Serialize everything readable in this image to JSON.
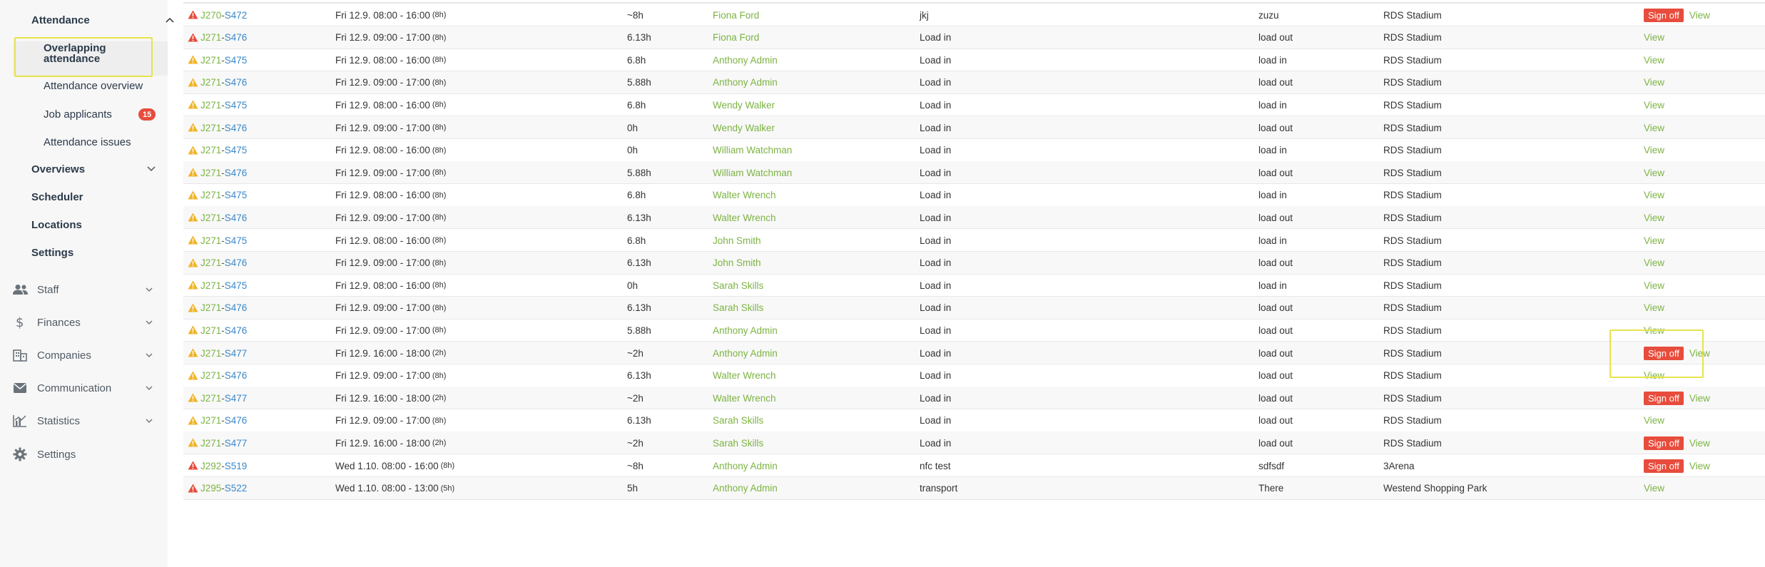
{
  "sidebar": {
    "attendance": "Attendance",
    "sub_items": [
      {
        "label": "Overlapping attendance",
        "key": "overlapping"
      },
      {
        "label": "Attendance overview",
        "key": "overview"
      },
      {
        "label": "Job applicants",
        "key": "applicants",
        "badge": "15"
      },
      {
        "label": "Attendance issues",
        "key": "issues"
      }
    ],
    "sections": [
      "Overviews",
      "Scheduler",
      "Locations",
      "Settings"
    ],
    "groups": [
      {
        "label": "Staff",
        "icon": "people-icon"
      },
      {
        "label": "Finances",
        "icon": "dollar-icon"
      },
      {
        "label": "Companies",
        "icon": "building-icon"
      },
      {
        "label": "Communication",
        "icon": "envelope-icon"
      },
      {
        "label": "Statistics",
        "icon": "chart-icon"
      }
    ],
    "settings": {
      "label": "Settings",
      "icon": "gear-icon"
    }
  },
  "labels": {
    "sign_off": "Sign off",
    "view": "View"
  },
  "colors": {
    "green": "#7cb342",
    "blue": "#3a87c8",
    "red": "#e74c3c",
    "warn_yellow": "#f0b429",
    "highlight": "#e7e34a"
  },
  "rows": [
    {
      "alert": "red",
      "job": "J270",
      "shift": "S472",
      "time": "Fri 12.9. 08:00 - 16:00",
      "hours": "(8h)",
      "duration": "~8h",
      "name": "Fiona Ford",
      "task": "jkj",
      "position": "zuzu",
      "location": "RDS Stadium",
      "sign_off": true
    },
    {
      "alert": "red",
      "job": "J271",
      "shift": "S476",
      "time": "Fri 12.9. 09:00 - 17:00",
      "hours": "(8h)",
      "duration": "6.13h",
      "name": "Fiona Ford",
      "task": "Load in",
      "position": "load out",
      "location": "RDS Stadium",
      "sign_off": false
    },
    {
      "alert": "yellow",
      "job": "J271",
      "shift": "S475",
      "time": "Fri 12.9. 08:00 - 16:00",
      "hours": "(8h)",
      "duration": "6.8h",
      "name": "Anthony Admin",
      "task": "Load in",
      "position": "load in",
      "location": "RDS Stadium",
      "sign_off": false
    },
    {
      "alert": "yellow",
      "job": "J271",
      "shift": "S476",
      "time": "Fri 12.9. 09:00 - 17:00",
      "hours": "(8h)",
      "duration": "5.88h",
      "name": "Anthony Admin",
      "task": "Load in",
      "position": "load out",
      "location": "RDS Stadium",
      "sign_off": false
    },
    {
      "alert": "yellow",
      "job": "J271",
      "shift": "S475",
      "time": "Fri 12.9. 08:00 - 16:00",
      "hours": "(8h)",
      "duration": "6.8h",
      "name": "Wendy Walker",
      "task": "Load in",
      "position": "load in",
      "location": "RDS Stadium",
      "sign_off": false
    },
    {
      "alert": "yellow",
      "job": "J271",
      "shift": "S476",
      "time": "Fri 12.9. 09:00 - 17:00",
      "hours": "(8h)",
      "duration": "0h",
      "name": "Wendy Walker",
      "task": "Load in",
      "position": "load out",
      "location": "RDS Stadium",
      "sign_off": false
    },
    {
      "alert": "yellow",
      "job": "J271",
      "shift": "S475",
      "time": "Fri 12.9. 08:00 - 16:00",
      "hours": "(8h)",
      "duration": "0h",
      "name": "William Watchman",
      "task": "Load in",
      "position": "load in",
      "location": "RDS Stadium",
      "sign_off": false
    },
    {
      "alert": "yellow",
      "job": "J271",
      "shift": "S476",
      "time": "Fri 12.9. 09:00 - 17:00",
      "hours": "(8h)",
      "duration": "5.88h",
      "name": "William Watchman",
      "task": "Load in",
      "position": "load out",
      "location": "RDS Stadium",
      "sign_off": false
    },
    {
      "alert": "yellow",
      "job": "J271",
      "shift": "S475",
      "time": "Fri 12.9. 08:00 - 16:00",
      "hours": "(8h)",
      "duration": "6.8h",
      "name": "Walter Wrench",
      "task": "Load in",
      "position": "load in",
      "location": "RDS Stadium",
      "sign_off": false
    },
    {
      "alert": "yellow",
      "job": "J271",
      "shift": "S476",
      "time": "Fri 12.9. 09:00 - 17:00",
      "hours": "(8h)",
      "duration": "6.13h",
      "name": "Walter Wrench",
      "task": "Load in",
      "position": "load out",
      "location": "RDS Stadium",
      "sign_off": false
    },
    {
      "alert": "yellow",
      "job": "J271",
      "shift": "S475",
      "time": "Fri 12.9. 08:00 - 16:00",
      "hours": "(8h)",
      "duration": "6.8h",
      "name": "John Smith",
      "task": "Load in",
      "position": "load in",
      "location": "RDS Stadium",
      "sign_off": false
    },
    {
      "alert": "yellow",
      "job": "J271",
      "shift": "S476",
      "time": "Fri 12.9. 09:00 - 17:00",
      "hours": "(8h)",
      "duration": "6.13h",
      "name": "John Smith",
      "task": "Load in",
      "position": "load out",
      "location": "RDS Stadium",
      "sign_off": false
    },
    {
      "alert": "yellow",
      "job": "J271",
      "shift": "S475",
      "time": "Fri 12.9. 08:00 - 16:00",
      "hours": "(8h)",
      "duration": "0h",
      "name": "Sarah Skills",
      "task": "Load in",
      "position": "load in",
      "location": "RDS Stadium",
      "sign_off": false
    },
    {
      "alert": "yellow",
      "job": "J271",
      "shift": "S476",
      "time": "Fri 12.9. 09:00 - 17:00",
      "hours": "(8h)",
      "duration": "6.13h",
      "name": "Sarah Skills",
      "task": "Load in",
      "position": "load out",
      "location": "RDS Stadium",
      "sign_off": false
    },
    {
      "alert": "yellow",
      "job": "J271",
      "shift": "S476",
      "time": "Fri 12.9. 09:00 - 17:00",
      "hours": "(8h)",
      "duration": "5.88h",
      "name": "Anthony Admin",
      "task": "Load in",
      "position": "load out",
      "location": "RDS Stadium",
      "sign_off": false
    },
    {
      "alert": "yellow",
      "job": "J271",
      "shift": "S477",
      "time": "Fri 12.9. 16:00 - 18:00",
      "hours": "(2h)",
      "duration": "~2h",
      "name": "Anthony Admin",
      "task": "Load in",
      "position": "load out",
      "location": "RDS Stadium",
      "sign_off": true
    },
    {
      "alert": "yellow",
      "job": "J271",
      "shift": "S476",
      "time": "Fri 12.9. 09:00 - 17:00",
      "hours": "(8h)",
      "duration": "6.13h",
      "name": "Walter Wrench",
      "task": "Load in",
      "position": "load out",
      "location": "RDS Stadium",
      "sign_off": false
    },
    {
      "alert": "yellow",
      "job": "J271",
      "shift": "S477",
      "time": "Fri 12.9. 16:00 - 18:00",
      "hours": "(2h)",
      "duration": "~2h",
      "name": "Walter Wrench",
      "task": "Load in",
      "position": "load out",
      "location": "RDS Stadium",
      "sign_off": true
    },
    {
      "alert": "yellow",
      "job": "J271",
      "shift": "S476",
      "time": "Fri 12.9. 09:00 - 17:00",
      "hours": "(8h)",
      "duration": "6.13h",
      "name": "Sarah Skills",
      "task": "Load in",
      "position": "load out",
      "location": "RDS Stadium",
      "sign_off": false
    },
    {
      "alert": "yellow",
      "job": "J271",
      "shift": "S477",
      "time": "Fri 12.9. 16:00 - 18:00",
      "hours": "(2h)",
      "duration": "~2h",
      "name": "Sarah Skills",
      "task": "Load in",
      "position": "load out",
      "location": "RDS Stadium",
      "sign_off": true
    },
    {
      "alert": "red",
      "job": "J292",
      "shift": "S519",
      "time": "Wed 1.10. 08:00 - 16:00",
      "hours": "(8h)",
      "duration": "~8h",
      "name": "Anthony Admin",
      "task": "nfc test",
      "position": "sdfsdf",
      "location": "3Arena",
      "sign_off": true
    },
    {
      "alert": "red",
      "job": "J295",
      "shift": "S522",
      "time": "Wed 1.10. 08:00 - 13:00",
      "hours": "(5h)",
      "duration": "5h",
      "name": "Anthony Admin",
      "task": "transport",
      "position": "There",
      "location": "Westend Shopping Park",
      "sign_off": false
    }
  ]
}
